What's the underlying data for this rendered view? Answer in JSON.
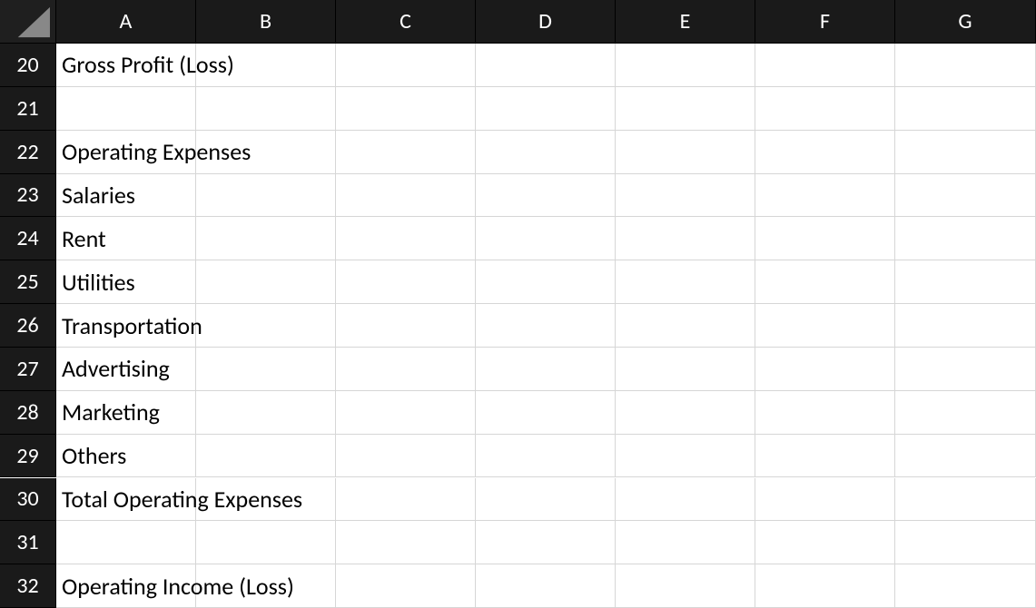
{
  "columns": [
    "A",
    "B",
    "C",
    "D",
    "E",
    "F",
    "G"
  ],
  "colWidths": {
    "rowHeader": 62,
    "A": 154,
    "B": 154,
    "C": 154,
    "D": 154,
    "E": 154,
    "F": 154,
    "G": 155
  },
  "rowNumbers": [
    20,
    21,
    22,
    23,
    24,
    25,
    26,
    27,
    28,
    29,
    30,
    31,
    32
  ],
  "headerHeight": 48,
  "rowHeight": 47.85,
  "cells": {
    "A20": "Gross Profit (Loss)",
    "A21": "",
    "A22": "Operating Expenses",
    "A23": "Salaries",
    "A24": "Rent",
    "A25": "Utilities",
    "A26": "Transportation",
    "A27": "Advertising",
    "A28": "Marketing",
    "A29": "Others",
    "A30": "Total Operating Expenses",
    "A31": "",
    "A32": "Operating Income (Loss)"
  }
}
